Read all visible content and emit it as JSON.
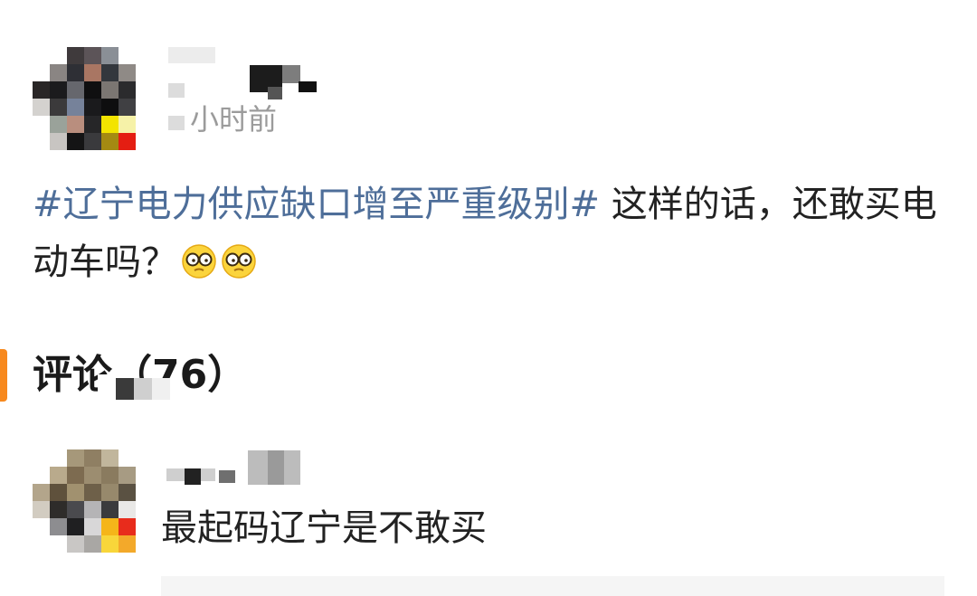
{
  "post": {
    "time_text": "小时前",
    "hashtag": "#辽宁电力供应缺口增至严重级别#",
    "body_text": " 这样的话，还敢买电动车吗？",
    "emoji": [
      "glasses-face-emoji",
      "glasses-face-emoji"
    ]
  },
  "comments_section": {
    "title": "评论",
    "count": "（76）",
    "accent_color": "#f7891e"
  },
  "comment": {
    "text": "最起码辽宁是不敢买"
  },
  "colors": {
    "hashtag": "#4e6e99",
    "text": "#222222",
    "muted": "#9b9b9b"
  }
}
